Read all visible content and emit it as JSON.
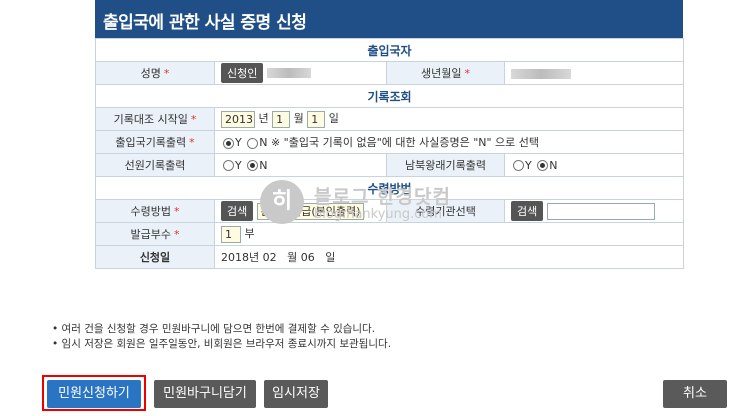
{
  "header": {
    "title": "출입국에 관한 사실 증명 신청"
  },
  "sections": {
    "applicant": "출입국자",
    "record": "기록조회",
    "receipt": "수령방법"
  },
  "applicant": {
    "name_label": "성명",
    "applicant_button": "신청인",
    "birth_label": "생년월일",
    "required_mark": "*"
  },
  "record": {
    "start_label": "기록대조 시작일",
    "start_year": "2013",
    "year_unit": "년",
    "start_month": "1",
    "month_unit": "월",
    "start_day": "1",
    "day_unit": "일",
    "immigration_label": "출입국기록출력",
    "y": "Y",
    "n": "N",
    "immigration_note": "※ \"출입국 기록이 없음\"에 대한 사실증명은 \"N\" 으로 선택",
    "crew_label": "선원기록출력",
    "nk_label": "남북왕래기록출력"
  },
  "receipt": {
    "method_label": "수령방법",
    "search": "검색",
    "method_value": "온라인발급(본인출력)",
    "office_label": "수령기관선택",
    "copies_label": "발급부수",
    "copies_value": "1",
    "copies_unit": "부",
    "apply_date_label": "신청일",
    "apply_date_value": "2018년 02   월 06   일"
  },
  "notes": [
    "• 여러 건을 신청할 경우 민원바구니에 담으면 한번에 결제할 수 있습니다.",
    "• 임시 저장은 회원은 일주일동안, 비회원은 브라우저 종료시까지 보관됩니다."
  ],
  "buttons": {
    "apply": "민원신청하기",
    "basket": "민원바구니담기",
    "temp_save": "임시저장",
    "cancel": "취소"
  },
  "watermark": {
    "line1": "블로그 한경닷컴",
    "line2": "blog.hankyung.com",
    "logo": "히"
  },
  "colors": {
    "header": "#1f4f86",
    "primary": "#2a74c4",
    "highlight": "#e00000"
  }
}
